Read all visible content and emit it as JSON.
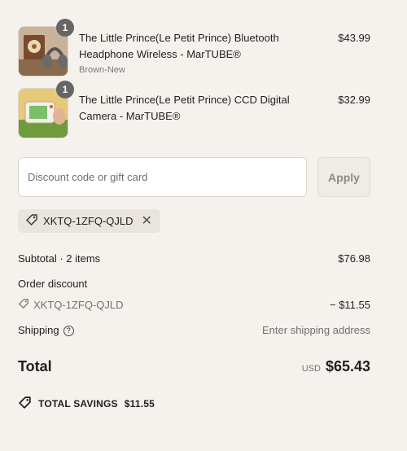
{
  "line_items": [
    {
      "quantity": "1",
      "title": "The Little Prince(Le Petit Prince) Bluetooth Headphone Wireless - MarTUBE®",
      "variant": "Brown-New",
      "price": "$43.99"
    },
    {
      "quantity": "1",
      "title": "The Little Prince(Le Petit Prince) CCD Digital Camera - MarTUBE®",
      "variant": "",
      "price": "$32.99"
    }
  ],
  "discount": {
    "placeholder": "Discount code or gift card",
    "apply_label": "Apply",
    "applied_code": "XKTQ-1ZFQ-QJLD",
    "remove_glyph": "✕"
  },
  "summary": {
    "subtotal_label": "Subtotal · 2 items",
    "subtotal_value": "$76.98",
    "order_discount_label": "Order discount",
    "order_discount_code": "XKTQ-1ZFQ-QJLD",
    "order_discount_value": "− $11.55",
    "shipping_label": "Shipping",
    "shipping_info_glyph": "?",
    "shipping_value": "Enter shipping address",
    "total_label": "Total",
    "total_currency": "USD",
    "total_value": "$65.43",
    "savings_label": "TOTAL SAVINGS",
    "savings_value": "$11.55"
  },
  "colors": {
    "background": "#f5f2ed",
    "badge": "#666666",
    "chip": "#e9e4dc"
  }
}
